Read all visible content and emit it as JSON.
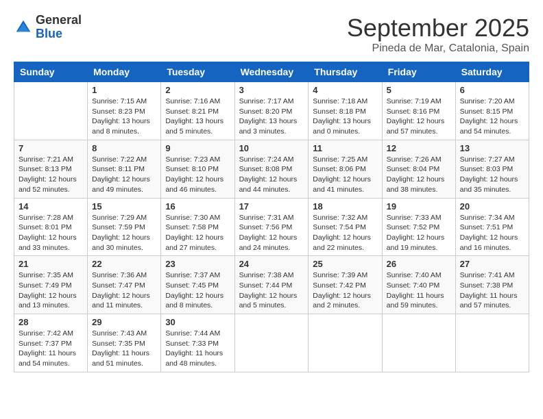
{
  "header": {
    "logo": {
      "general": "General",
      "blue": "Blue"
    },
    "month": "September 2025",
    "location": "Pineda de Mar, Catalonia, Spain"
  },
  "weekdays": [
    "Sunday",
    "Monday",
    "Tuesday",
    "Wednesday",
    "Thursday",
    "Friday",
    "Saturday"
  ],
  "weeks": [
    [
      {
        "day": "",
        "info": ""
      },
      {
        "day": "1",
        "info": "Sunrise: 7:15 AM\nSunset: 8:23 PM\nDaylight: 13 hours\nand 8 minutes."
      },
      {
        "day": "2",
        "info": "Sunrise: 7:16 AM\nSunset: 8:21 PM\nDaylight: 13 hours\nand 5 minutes."
      },
      {
        "day": "3",
        "info": "Sunrise: 7:17 AM\nSunset: 8:20 PM\nDaylight: 13 hours\nand 3 minutes."
      },
      {
        "day": "4",
        "info": "Sunrise: 7:18 AM\nSunset: 8:18 PM\nDaylight: 13 hours\nand 0 minutes."
      },
      {
        "day": "5",
        "info": "Sunrise: 7:19 AM\nSunset: 8:16 PM\nDaylight: 12 hours\nand 57 minutes."
      },
      {
        "day": "6",
        "info": "Sunrise: 7:20 AM\nSunset: 8:15 PM\nDaylight: 12 hours\nand 54 minutes."
      }
    ],
    [
      {
        "day": "7",
        "info": "Sunrise: 7:21 AM\nSunset: 8:13 PM\nDaylight: 12 hours\nand 52 minutes."
      },
      {
        "day": "8",
        "info": "Sunrise: 7:22 AM\nSunset: 8:11 PM\nDaylight: 12 hours\nand 49 minutes."
      },
      {
        "day": "9",
        "info": "Sunrise: 7:23 AM\nSunset: 8:10 PM\nDaylight: 12 hours\nand 46 minutes."
      },
      {
        "day": "10",
        "info": "Sunrise: 7:24 AM\nSunset: 8:08 PM\nDaylight: 12 hours\nand 44 minutes."
      },
      {
        "day": "11",
        "info": "Sunrise: 7:25 AM\nSunset: 8:06 PM\nDaylight: 12 hours\nand 41 minutes."
      },
      {
        "day": "12",
        "info": "Sunrise: 7:26 AM\nSunset: 8:04 PM\nDaylight: 12 hours\nand 38 minutes."
      },
      {
        "day": "13",
        "info": "Sunrise: 7:27 AM\nSunset: 8:03 PM\nDaylight: 12 hours\nand 35 minutes."
      }
    ],
    [
      {
        "day": "14",
        "info": "Sunrise: 7:28 AM\nSunset: 8:01 PM\nDaylight: 12 hours\nand 33 minutes."
      },
      {
        "day": "15",
        "info": "Sunrise: 7:29 AM\nSunset: 7:59 PM\nDaylight: 12 hours\nand 30 minutes."
      },
      {
        "day": "16",
        "info": "Sunrise: 7:30 AM\nSunset: 7:58 PM\nDaylight: 12 hours\nand 27 minutes."
      },
      {
        "day": "17",
        "info": "Sunrise: 7:31 AM\nSunset: 7:56 PM\nDaylight: 12 hours\nand 24 minutes."
      },
      {
        "day": "18",
        "info": "Sunrise: 7:32 AM\nSunset: 7:54 PM\nDaylight: 12 hours\nand 22 minutes."
      },
      {
        "day": "19",
        "info": "Sunrise: 7:33 AM\nSunset: 7:52 PM\nDaylight: 12 hours\nand 19 minutes."
      },
      {
        "day": "20",
        "info": "Sunrise: 7:34 AM\nSunset: 7:51 PM\nDaylight: 12 hours\nand 16 minutes."
      }
    ],
    [
      {
        "day": "21",
        "info": "Sunrise: 7:35 AM\nSunset: 7:49 PM\nDaylight: 12 hours\nand 13 minutes."
      },
      {
        "day": "22",
        "info": "Sunrise: 7:36 AM\nSunset: 7:47 PM\nDaylight: 12 hours\nand 11 minutes."
      },
      {
        "day": "23",
        "info": "Sunrise: 7:37 AM\nSunset: 7:45 PM\nDaylight: 12 hours\nand 8 minutes."
      },
      {
        "day": "24",
        "info": "Sunrise: 7:38 AM\nSunset: 7:44 PM\nDaylight: 12 hours\nand 5 minutes."
      },
      {
        "day": "25",
        "info": "Sunrise: 7:39 AM\nSunset: 7:42 PM\nDaylight: 12 hours\nand 2 minutes."
      },
      {
        "day": "26",
        "info": "Sunrise: 7:40 AM\nSunset: 7:40 PM\nDaylight: 11 hours\nand 59 minutes."
      },
      {
        "day": "27",
        "info": "Sunrise: 7:41 AM\nSunset: 7:38 PM\nDaylight: 11 hours\nand 57 minutes."
      }
    ],
    [
      {
        "day": "28",
        "info": "Sunrise: 7:42 AM\nSunset: 7:37 PM\nDaylight: 11 hours\nand 54 minutes."
      },
      {
        "day": "29",
        "info": "Sunrise: 7:43 AM\nSunset: 7:35 PM\nDaylight: 11 hours\nand 51 minutes."
      },
      {
        "day": "30",
        "info": "Sunrise: 7:44 AM\nSunset: 7:33 PM\nDaylight: 11 hours\nand 48 minutes."
      },
      {
        "day": "",
        "info": ""
      },
      {
        "day": "",
        "info": ""
      },
      {
        "day": "",
        "info": ""
      },
      {
        "day": "",
        "info": ""
      }
    ]
  ]
}
